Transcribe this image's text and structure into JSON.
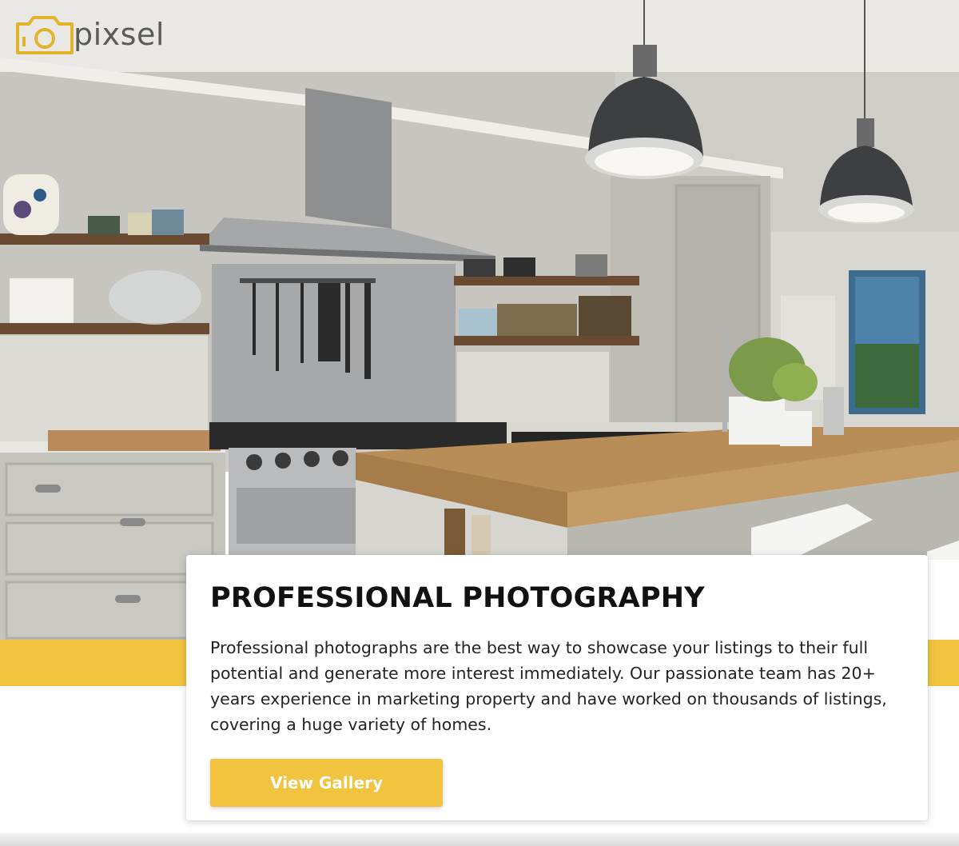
{
  "brand": {
    "name": "pixsel",
    "accent": "#f1c33f"
  },
  "logo_icon": "camera-icon",
  "hero": {
    "image": "kitchen-interior-photo"
  },
  "card": {
    "title": "PROFESSIONAL PHOTOGRAPHY",
    "body": "Professional photographs are the best way to showcase your listings to their full potential and generate more interest immediately. Our passionate team has 20+ years experience in marketing property and have worked on thousands of listings, covering a huge variety of homes.",
    "button_label": "View Gallery"
  }
}
